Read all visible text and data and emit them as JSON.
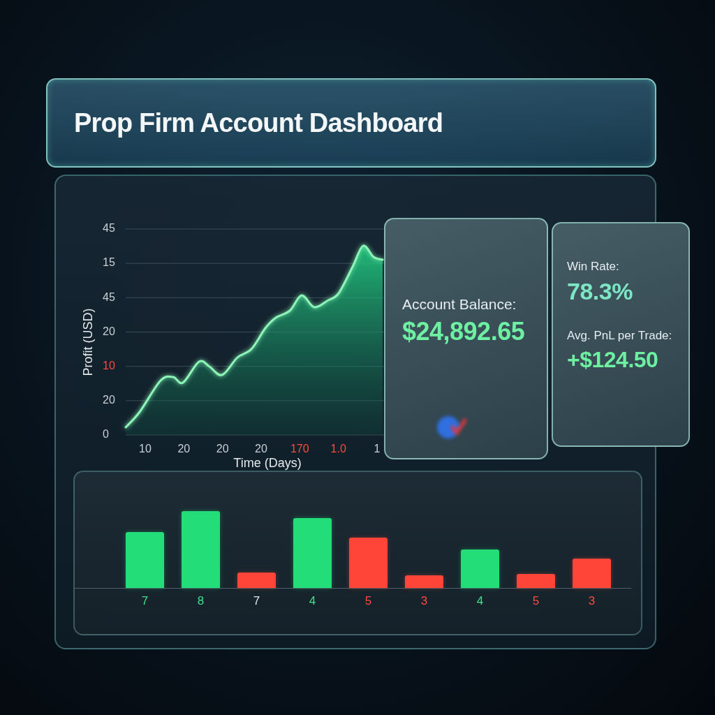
{
  "title": "Prop Firm Account Dashboard",
  "profit_chart": {
    "ylabel": "Profit (USD)",
    "xlabel": "Time (Days)",
    "y_ticks": [
      {
        "text": "45",
        "color": "#c8d0d6"
      },
      {
        "text": "15",
        "color": "#c8d0d6"
      },
      {
        "text": "45",
        "color": "#c8d0d6"
      },
      {
        "text": "20",
        "color": "#c8d0d6"
      },
      {
        "text": "10",
        "color": "#ff4a3d"
      },
      {
        "text": "20",
        "color": "#c8d0d6"
      },
      {
        "text": "0",
        "color": "#c8d0d6"
      }
    ],
    "x_ticks": [
      {
        "text": "10",
        "color": "#c8d0d6"
      },
      {
        "text": "20",
        "color": "#c8d0d6"
      },
      {
        "text": "20",
        "color": "#c8d0d6"
      },
      {
        "text": "20",
        "color": "#c8d0d6"
      },
      {
        "text": "170",
        "color": "#ff4a3d"
      },
      {
        "text": "1.0",
        "color": "#ff4a3d"
      },
      {
        "text": "1",
        "color": "#c8d0d6"
      }
    ]
  },
  "cards": [
    {
      "kind": "balance",
      "metrics": [
        {
          "label": "Account Balance:",
          "value": "$24,892.65",
          "color": "#6ef0a2"
        }
      ]
    },
    {
      "kind": "stats",
      "metrics": [
        {
          "label": "Win Rate:",
          "value": "78.3%",
          "color": "#7de6c4"
        },
        {
          "label": "Avg. PnL per Trade:",
          "value": "+$124.50",
          "color": "#6ef0a2"
        }
      ]
    }
  ],
  "bar_panel": {
    "bars": [
      {
        "color": "#22dd78",
        "label": {
          "text": "7",
          "color": "#3fe08a"
        }
      },
      {
        "color": "#22dd78",
        "label": {
          "text": "8",
          "color": "#3fe08a"
        }
      },
      {
        "color": "#ff4438",
        "label": {
          "text": "7",
          "color": "#dfe5ea"
        }
      },
      {
        "color": "#22dd78",
        "label": {
          "text": "4",
          "color": "#3fe08a"
        }
      },
      {
        "color": "#ff4438",
        "label": {
          "text": "5",
          "color": "#ff4b3e"
        }
      },
      {
        "color": "#ff4438",
        "label": {
          "text": "3",
          "color": "#ff4b3e"
        }
      },
      {
        "color": "#22dd78",
        "label": {
          "text": "4",
          "color": "#3fe08a"
        }
      },
      {
        "color": "#ff4438",
        "label": {
          "text": "5",
          "color": "#ff4b3e"
        }
      },
      {
        "color": "#ff4438",
        "label": {
          "text": "3",
          "color": "#ff4b3e"
        }
      }
    ]
  }
}
